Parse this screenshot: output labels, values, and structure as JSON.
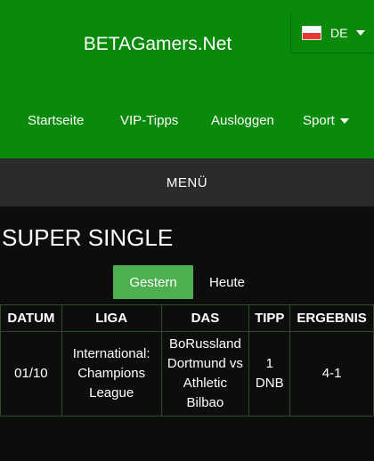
{
  "header": {
    "brand": "BETAGamers.Net",
    "language": "DE",
    "nav": [
      {
        "label": "Startseite"
      },
      {
        "label": "VIP-Tipps"
      },
      {
        "label": "Ausloggen"
      },
      {
        "label": "Sport"
      }
    ]
  },
  "menu": {
    "label": "MENÜ"
  },
  "page": {
    "title": "SUPER SINGLE"
  },
  "tabs": {
    "gestern": "Gestern",
    "heute": "Heute"
  },
  "table": {
    "headers": [
      "DATUM",
      "LIGA",
      "DAS",
      "TIPP",
      "ERGEBNIS"
    ],
    "rows": [
      {
        "datum": "01/10",
        "liga": "International: Champions League",
        "das": "BoRussland Dortmund vs Athletic Bilbao",
        "tipp": "1 DNB",
        "ergebnis": "4-1"
      }
    ]
  },
  "colors": {
    "header_bg": "#0a8a0a",
    "active_tab": "#4caf50",
    "menu_bg": "#2b2b2b",
    "page_bg": "#0d0d0d"
  }
}
